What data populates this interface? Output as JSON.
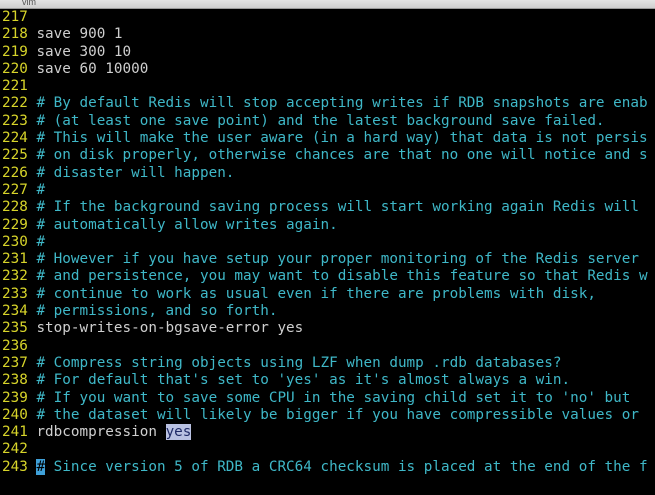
{
  "window": {
    "title": "vim"
  },
  "editor": {
    "lines": [
      {
        "num": "217",
        "text": "",
        "type": "plain"
      },
      {
        "num": "218",
        "text": "save 900 1",
        "type": "plain"
      },
      {
        "num": "219",
        "text": "save 300 10",
        "type": "plain"
      },
      {
        "num": "220",
        "text": "save 60 10000",
        "type": "plain"
      },
      {
        "num": "221",
        "text": "",
        "type": "plain"
      },
      {
        "num": "222",
        "text": "# By default Redis will stop accepting writes if RDB snapshots are enab",
        "type": "comment"
      },
      {
        "num": "223",
        "text": "# (at least one save point) and the latest background save failed.",
        "type": "comment"
      },
      {
        "num": "224",
        "text": "# This will make the user aware (in a hard way) that data is not persis",
        "type": "comment"
      },
      {
        "num": "225",
        "text": "# on disk properly, otherwise chances are that no one will notice and s",
        "type": "comment"
      },
      {
        "num": "226",
        "text": "# disaster will happen.",
        "type": "comment"
      },
      {
        "num": "227",
        "text": "#",
        "type": "comment"
      },
      {
        "num": "228",
        "text": "# If the background saving process will start working again Redis will",
        "type": "comment"
      },
      {
        "num": "229",
        "text": "# automatically allow writes again.",
        "type": "comment"
      },
      {
        "num": "230",
        "text": "#",
        "type": "comment"
      },
      {
        "num": "231",
        "text": "# However if you have setup your proper monitoring of the Redis server",
        "type": "comment"
      },
      {
        "num": "232",
        "text": "# and persistence, you may want to disable this feature so that Redis w",
        "type": "comment"
      },
      {
        "num": "233",
        "text": "# continue to work as usual even if there are problems with disk,",
        "type": "comment"
      },
      {
        "num": "234",
        "text": "# permissions, and so forth.",
        "type": "comment"
      },
      {
        "num": "235",
        "text": "stop-writes-on-bgsave-error yes",
        "type": "plain"
      },
      {
        "num": "236",
        "text": "",
        "type": "plain"
      },
      {
        "num": "237",
        "text": "# Compress string objects using LZF when dump .rdb databases?",
        "type": "comment"
      },
      {
        "num": "238",
        "text": "# For default that's set to 'yes' as it's almost always a win.",
        "type": "comment"
      },
      {
        "num": "239",
        "text": "# If you want to save some CPU in the saving child set it to 'no' but",
        "type": "comment"
      },
      {
        "num": "240",
        "text": "# the dataset will likely be bigger if you have compressible values or",
        "type": "comment"
      },
      {
        "num": "241",
        "text_before": "rdbcompression ",
        "text_highlight": "yes",
        "type": "highlight"
      },
      {
        "num": "242",
        "text": "",
        "type": "plain"
      },
      {
        "num": "243",
        "cursor_char": "#",
        "text_after": " Since version 5 of RDB a CRC64 checksum is placed at the end of the f",
        "type": "cursor"
      }
    ]
  },
  "colors": {
    "background": "#000000",
    "line_number": "#d7d42a",
    "comment": "#3fb8c8",
    "text": "#cfcfcf",
    "search_highlight_bg": "#b9c1e2",
    "cursor_bg": "#3fa0d8"
  }
}
